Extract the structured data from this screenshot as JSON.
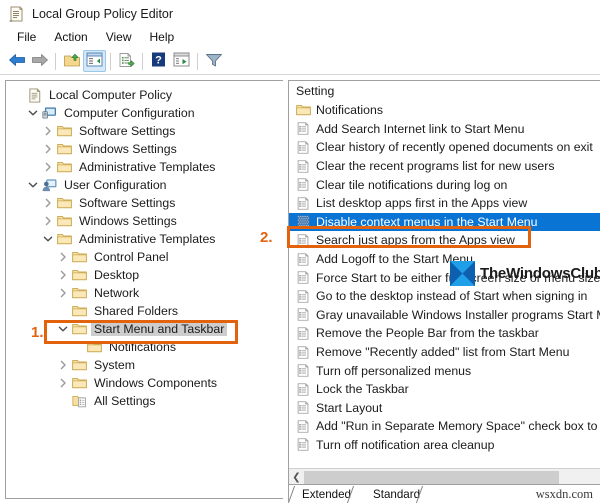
{
  "window": {
    "title": "Local Group Policy Editor",
    "icon": "policy-document-icon"
  },
  "menubar": {
    "items": [
      {
        "label": "File",
        "name": "menu-file"
      },
      {
        "label": "Action",
        "name": "menu-action"
      },
      {
        "label": "View",
        "name": "menu-view"
      },
      {
        "label": "Help",
        "name": "menu-help"
      }
    ]
  },
  "toolbar": {
    "buttons": [
      {
        "icon": "back-arrow-icon",
        "name": "toolbar-back"
      },
      {
        "icon": "forward-arrow-icon",
        "name": "toolbar-forward"
      },
      {
        "icon": "up-folder-icon",
        "name": "toolbar-up-one-level"
      },
      {
        "icon": "show-hide-tree-icon",
        "name": "toolbar-show-hide-console-tree",
        "selected": true
      },
      {
        "icon": "properties-icon",
        "name": "toolbar-properties"
      },
      {
        "icon": "help-icon",
        "name": "toolbar-help"
      },
      {
        "icon": "export-list-icon",
        "name": "toolbar-export-list"
      },
      {
        "icon": "filter-icon",
        "name": "toolbar-filter"
      }
    ]
  },
  "tree": {
    "nodes": [
      {
        "label": "Local Computer Policy",
        "indent": 0,
        "twist": "none",
        "icon": "policy-document-icon"
      },
      {
        "label": "Computer Configuration",
        "indent": 1,
        "twist": "expanded",
        "icon": "computer-icon"
      },
      {
        "label": "Software Settings",
        "indent": 2,
        "twist": "collapsed",
        "icon": "folder-icon"
      },
      {
        "label": "Windows Settings",
        "indent": 2,
        "twist": "collapsed",
        "icon": "folder-icon"
      },
      {
        "label": "Administrative Templates",
        "indent": 2,
        "twist": "collapsed",
        "icon": "folder-icon"
      },
      {
        "label": "User Configuration",
        "indent": 1,
        "twist": "expanded",
        "icon": "user-icon"
      },
      {
        "label": "Software Settings",
        "indent": 2,
        "twist": "collapsed",
        "icon": "folder-icon"
      },
      {
        "label": "Windows Settings",
        "indent": 2,
        "twist": "collapsed",
        "icon": "folder-icon"
      },
      {
        "label": "Administrative Templates",
        "indent": 2,
        "twist": "expanded",
        "icon": "folder-icon"
      },
      {
        "label": "Control Panel",
        "indent": 3,
        "twist": "collapsed",
        "icon": "folder-icon"
      },
      {
        "label": "Desktop",
        "indent": 3,
        "twist": "collapsed",
        "icon": "folder-icon"
      },
      {
        "label": "Network",
        "indent": 3,
        "twist": "collapsed",
        "icon": "folder-icon"
      },
      {
        "label": "Shared Folders",
        "indent": 3,
        "twist": "none",
        "icon": "folder-icon"
      },
      {
        "label": "Start Menu and Taskbar",
        "indent": 3,
        "twist": "expanded",
        "icon": "folder-icon",
        "selected": true
      },
      {
        "label": "Notifications",
        "indent": 4,
        "twist": "none",
        "icon": "folder-icon"
      },
      {
        "label": "System",
        "indent": 3,
        "twist": "collapsed",
        "icon": "folder-icon"
      },
      {
        "label": "Windows Components",
        "indent": 3,
        "twist": "collapsed",
        "icon": "folder-icon"
      },
      {
        "label": "All Settings",
        "indent": 3,
        "twist": "none",
        "icon": "all-settings-icon"
      }
    ]
  },
  "list": {
    "header": "Setting",
    "rows": [
      {
        "label": "Notifications",
        "icon": "folder-icon"
      },
      {
        "label": "Add Search Internet link to Start Menu",
        "icon": "policy-setting-icon"
      },
      {
        "label": "Clear history of recently opened documents on exit",
        "icon": "policy-setting-icon"
      },
      {
        "label": "Clear the recent programs list for new users",
        "icon": "policy-setting-icon"
      },
      {
        "label": "Clear tile notifications during log on",
        "icon": "policy-setting-icon"
      },
      {
        "label": "List desktop apps first in the Apps view",
        "icon": "policy-setting-icon"
      },
      {
        "label": "Disable context menus in the Start Menu",
        "icon": "policy-setting-selected-icon",
        "selected": true
      },
      {
        "label": "Search just apps from the Apps view",
        "icon": "policy-setting-icon"
      },
      {
        "label": "Add Logoff to the Start Menu",
        "icon": "policy-setting-icon"
      },
      {
        "label": "Force Start to be either full screen size or menu size",
        "icon": "policy-setting-icon"
      },
      {
        "label": "Go to the desktop instead of Start when signing in",
        "icon": "policy-setting-icon"
      },
      {
        "label": "Gray unavailable Windows Installer programs Start Menu",
        "icon": "policy-setting-icon"
      },
      {
        "label": "Remove the People Bar from the taskbar",
        "icon": "policy-setting-icon"
      },
      {
        "label": "Remove \"Recently added\" list from Start Menu",
        "icon": "policy-setting-icon"
      },
      {
        "label": "Turn off personalized menus",
        "icon": "policy-setting-icon"
      },
      {
        "label": "Lock the Taskbar",
        "icon": "policy-setting-icon"
      },
      {
        "label": "Start Layout",
        "icon": "policy-setting-icon"
      },
      {
        "label": "Add \"Run in Separate Memory Space\" check box to Run",
        "icon": "policy-setting-icon"
      },
      {
        "label": "Turn off notification area cleanup",
        "icon": "policy-setting-icon"
      }
    ]
  },
  "tabs": [
    {
      "label": "Extended",
      "name": "tab-extended"
    },
    {
      "label": "Standard",
      "name": "tab-standard"
    }
  ],
  "annotations": {
    "step1": "1.",
    "step2": "2.",
    "accent_color": "#e2620d"
  },
  "watermark": {
    "brand": "TheWindowsClub",
    "site": "wsxdn.com"
  },
  "colors": {
    "selection_blue": "#0a74d4",
    "tree_selection_gray": "#cdcdcd",
    "annotation_orange": "#e2620d"
  }
}
